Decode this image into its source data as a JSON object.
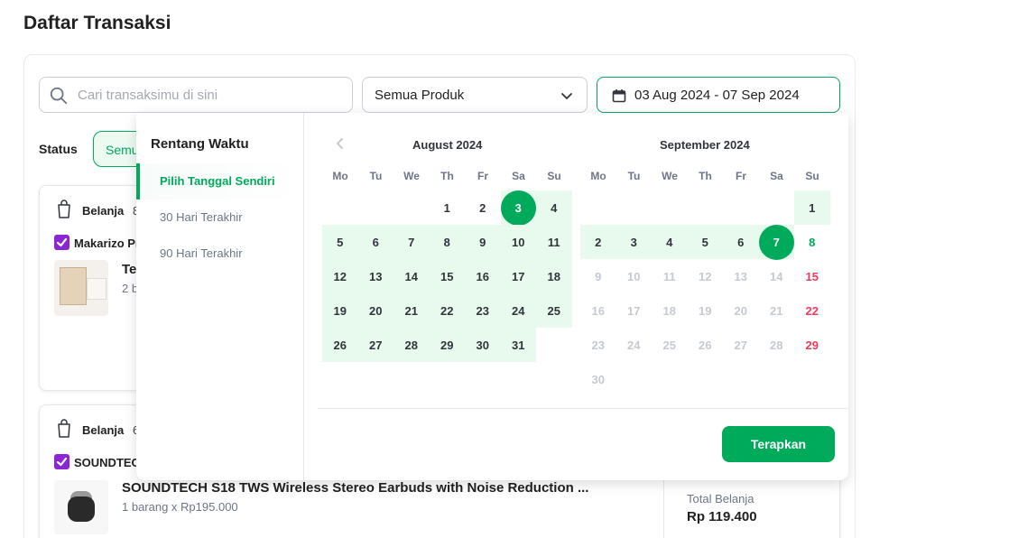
{
  "page": {
    "title": "Daftar Transaksi"
  },
  "filters": {
    "search_placeholder": "Cari transaksimu di sini",
    "product_select": "Semua Produk",
    "date_range": "03 Aug 2024 - 07 Sep 2024",
    "status_label": "Status",
    "status_chip": "Semu"
  },
  "transactions": [
    {
      "type": "Belanja",
      "date_fragment": "8",
      "shop": "Makarizo Pr",
      "product_name": "Te",
      "quantity": "2 b"
    },
    {
      "type": "Belanja",
      "date_fragment": "6",
      "shop": "SOUNDTECH",
      "product_name": "SOUNDTECH S18 TWS Wireless Stereo Earbuds with Noise Reduction ...",
      "quantity": "1 barang x Rp195.000",
      "total_label": "Total Belanja",
      "total_value": "Rp 119.400"
    }
  ],
  "date_picker": {
    "range_title": "Rentang Waktu",
    "range_options": [
      "Pilih Tanggal Sendiri",
      "30 Hari Terakhir",
      "90 Hari Terakhir"
    ],
    "active_option": "Pilih Tanggal Sendiri",
    "weekdays": [
      "Mo",
      "Tu",
      "We",
      "Th",
      "Fr",
      "Sa",
      "Su"
    ],
    "months": [
      {
        "title": "August 2024",
        "first_weekday_index": 3,
        "days_in_month": 31,
        "range_start": 3,
        "range_end": 31,
        "selected": [
          3
        ]
      },
      {
        "title": "September 2024",
        "first_weekday_index": 6,
        "days_in_month": 30,
        "range_start": 1,
        "range_end": 7,
        "selected": [
          7
        ],
        "disabled_after": 7,
        "red_days": [
          15,
          22,
          29
        ],
        "green_days": [
          8
        ]
      }
    ],
    "apply_label": "Terapkan"
  },
  "colors": {
    "accent": "#00aa5b",
    "range_bg": "#e8f9ee",
    "holiday": "#ef3a5d",
    "shop_badge": "#8c26d4"
  }
}
